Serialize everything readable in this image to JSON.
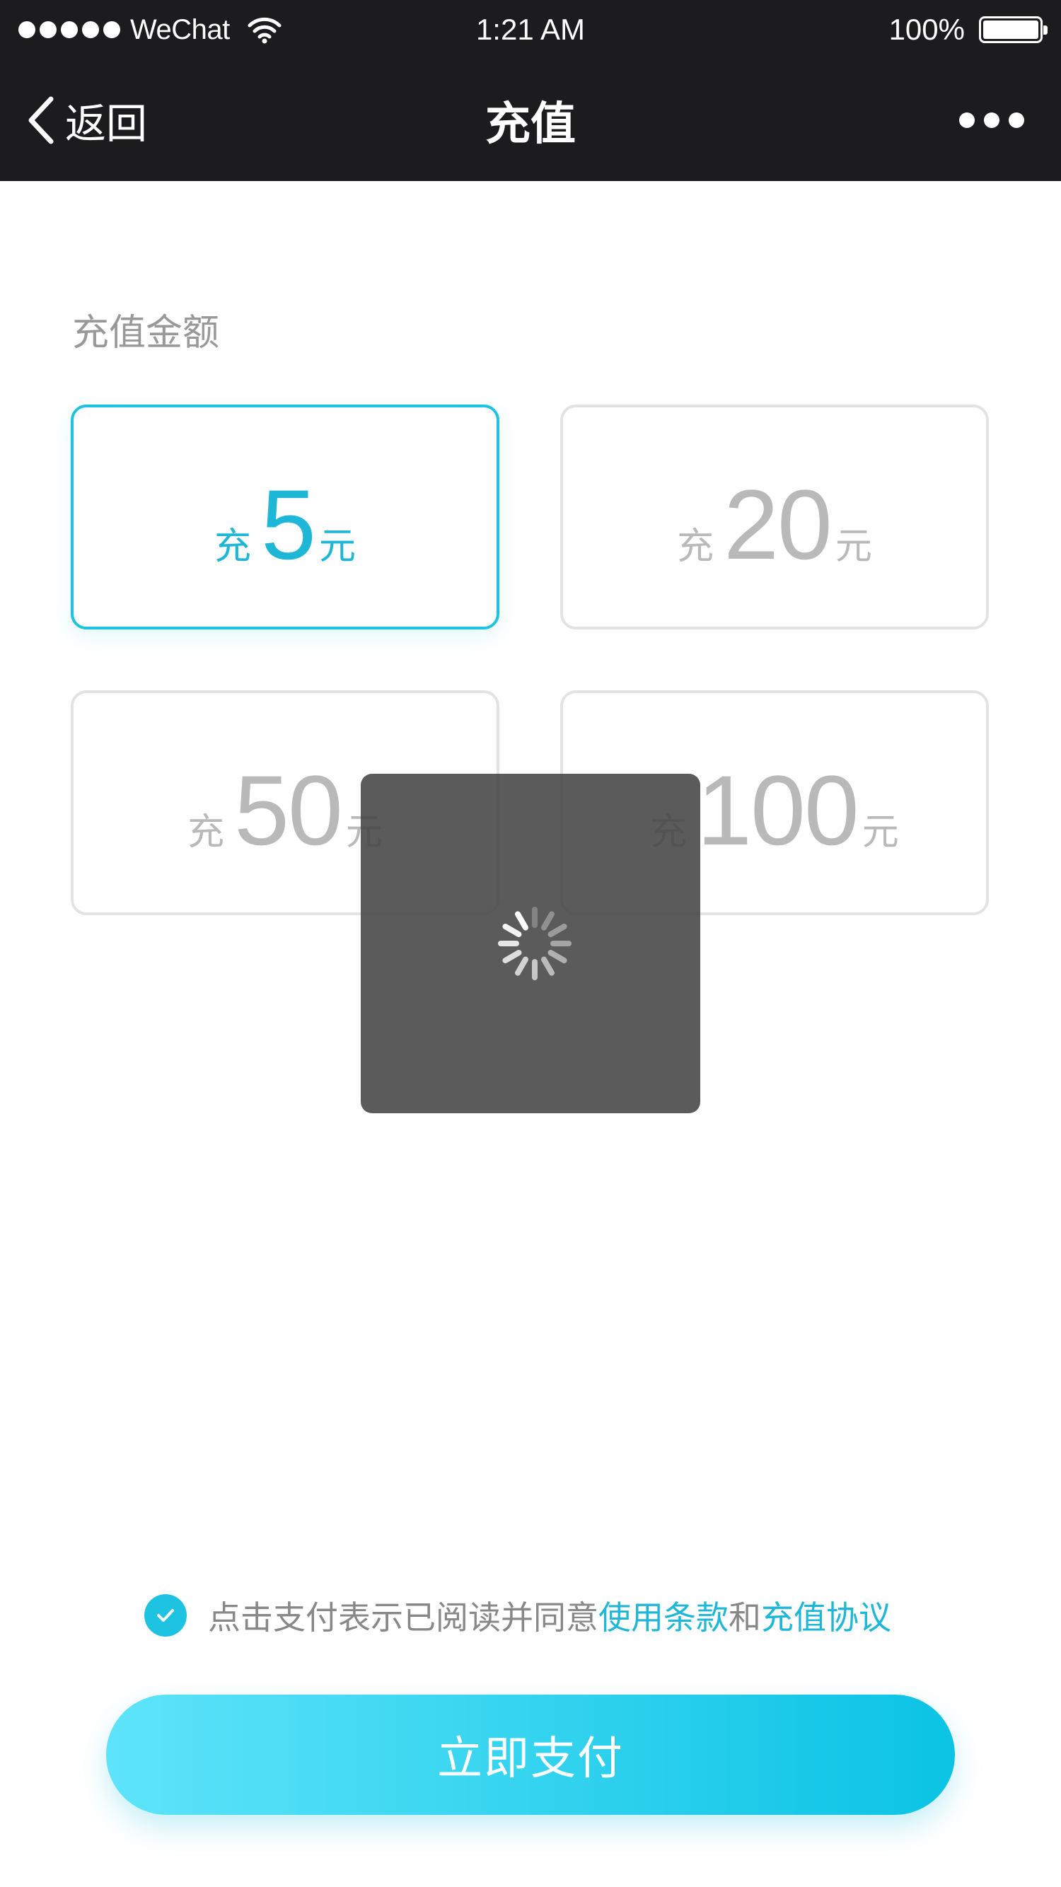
{
  "status_bar": {
    "carrier": "WeChat",
    "time": "1:21 AM",
    "battery_percent": "100%",
    "signal_icon": "signal-dots-icon",
    "wifi_icon": "wifi-icon",
    "battery_icon": "battery-icon"
  },
  "nav": {
    "back_label": "返回",
    "title": "充值",
    "back_icon": "chevron-left-icon",
    "more_icon": "more-dots-icon"
  },
  "recharge": {
    "label": "充值金额",
    "options": [
      {
        "prefix": "充",
        "amount": "5",
        "suffix": "元",
        "selected": true
      },
      {
        "prefix": "充",
        "amount": "20",
        "suffix": "元",
        "selected": false
      },
      {
        "prefix": "充",
        "amount": "50",
        "suffix": "元",
        "selected": false
      },
      {
        "prefix": "充",
        "amount": "100",
        "suffix": "元",
        "selected": false
      }
    ]
  },
  "loading": {
    "icon": "loading-spinner-icon"
  },
  "agreement": {
    "checked": true,
    "check_icon": "checkmark-icon",
    "text": "点击支付表示已阅读并同意",
    "terms_link": "使用条款",
    "conjunction": "和",
    "protocol_link": "充值协议"
  },
  "pay_button": {
    "label": "立即支付"
  },
  "colors": {
    "accent": "#1fc3e2",
    "header_bg": "#1c1c1e",
    "muted_text": "#999999",
    "unselected_border": "#e3e3e3"
  }
}
